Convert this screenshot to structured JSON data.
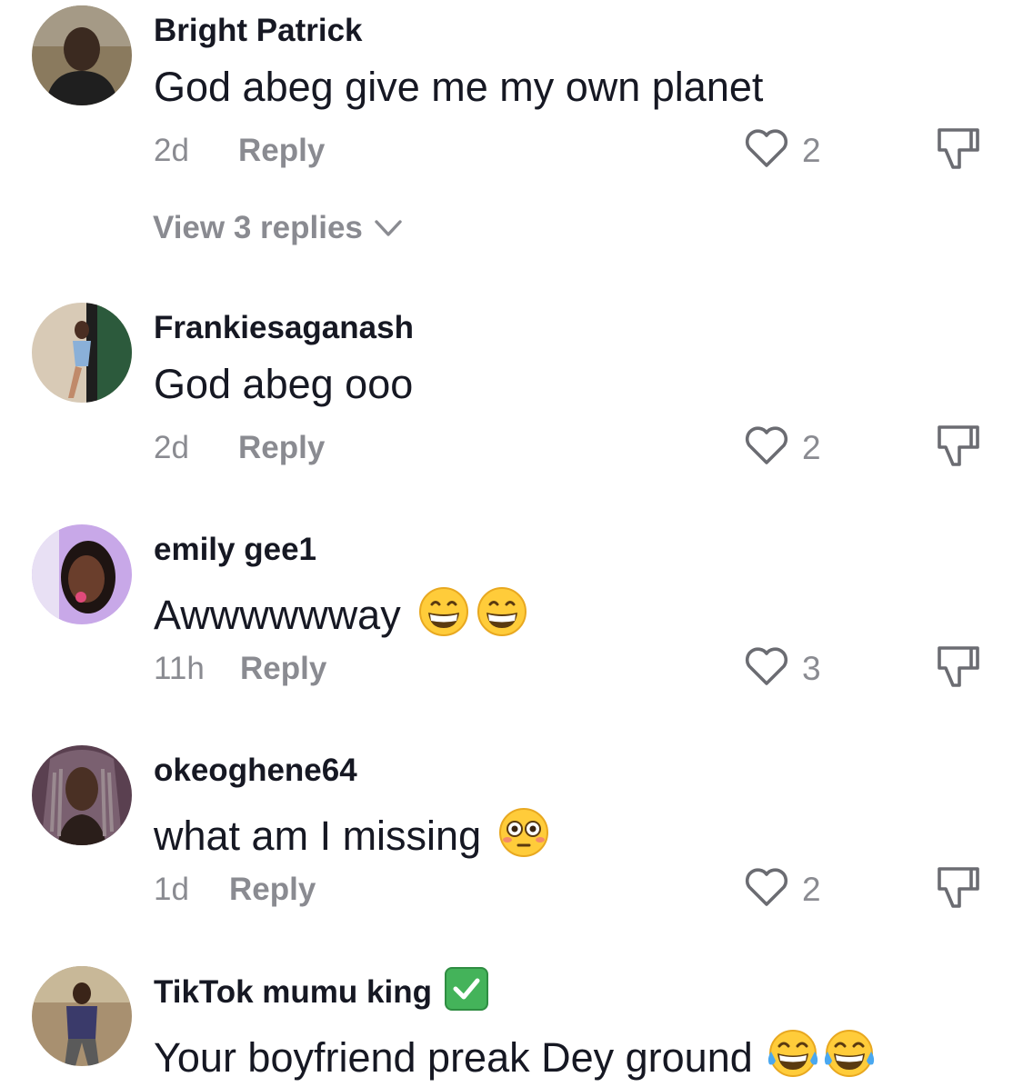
{
  "comments": [
    {
      "username": "Bright Patrick",
      "text": "God abeg give me my own planet",
      "emojis": [],
      "time": "2d",
      "reply_label": "Reply",
      "likes": "2",
      "view_replies": "View 3 replies",
      "avatar_colors": [
        "#7a6a52",
        "#2a2a2a"
      ]
    },
    {
      "username": "Frankiesaganash",
      "text": "God abeg ooo",
      "emojis": [],
      "time": "2d",
      "reply_label": "Reply",
      "likes": "2",
      "avatar_colors": [
        "#d9cbb8",
        "#2a5a3a"
      ]
    },
    {
      "username": "emily gee1",
      "text": "Awwwwwway",
      "emojis": [
        "grinning-face",
        "grinning-face"
      ],
      "time": "11h",
      "reply_label": "Reply",
      "likes": "3",
      "avatar_colors": [
        "#c7a5e8",
        "#3a2320"
      ]
    },
    {
      "username": "okeoghene64",
      "text": "what am I missing",
      "emojis": [
        "flushed-face"
      ],
      "time": "1d",
      "reply_label": "Reply",
      "likes": "2",
      "avatar_colors": [
        "#6a5060",
        "#3b2a24"
      ]
    },
    {
      "username": "TikTok mumu king",
      "verified_badge": "check-mark-icon",
      "text": "Your boyfriend preak Dey ground",
      "emojis": [
        "tears-of-joy-face",
        "tears-of-joy-face"
      ],
      "avatar_colors": [
        "#a89070",
        "#3a3a6a"
      ]
    }
  ],
  "colors": {
    "primary_text": "#161823",
    "secondary_text": "#8a8b91",
    "verified": "#44b35a"
  }
}
